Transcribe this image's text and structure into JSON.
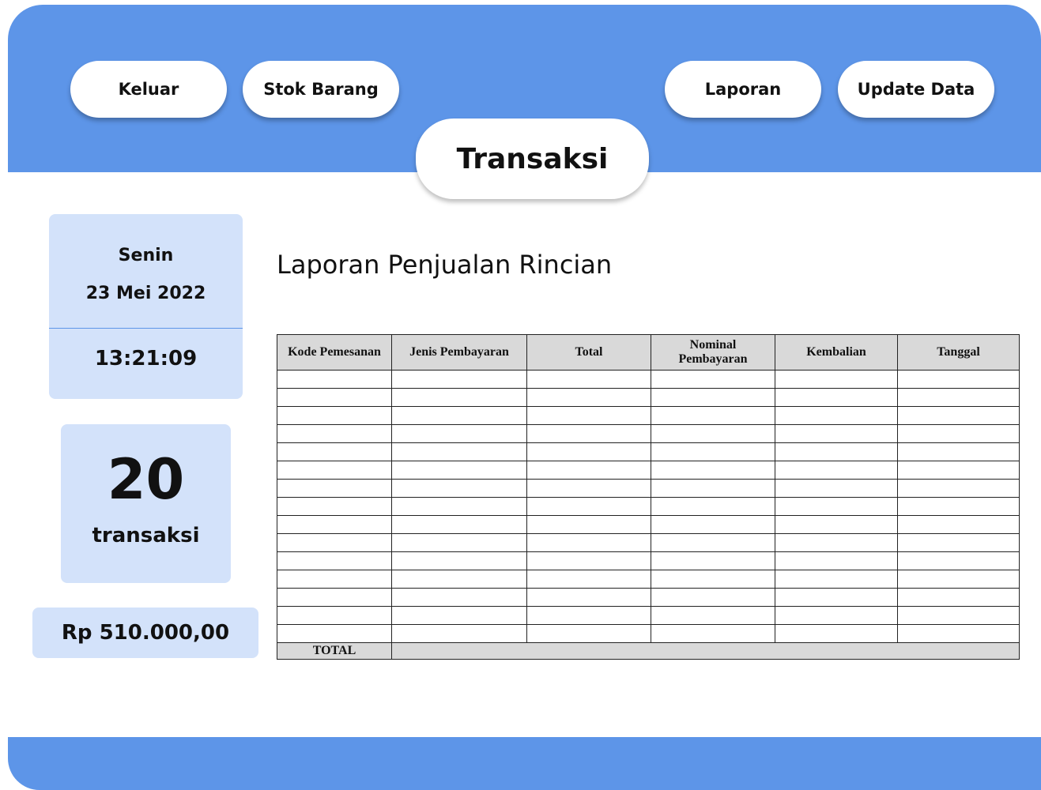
{
  "nav": {
    "keluar": "Keluar",
    "stok_barang": "Stok Barang",
    "laporan": "Laporan",
    "update_data": "Update Data"
  },
  "page_title": "Transaksi",
  "info": {
    "day": "Senin",
    "date": "23 Mei 2022",
    "time": "13:21:09",
    "transaction_count": "20",
    "transaction_label": "transaksi",
    "total_amount": "Rp 510.000,00"
  },
  "report": {
    "title": "Laporan Penjualan Rincian",
    "columns": [
      "Kode Pemesanan",
      "Jenis Pembayaran",
      "Total",
      "Nominal Pembayaran",
      "Kembalian",
      "Tanggal"
    ],
    "empty_row_count": 15,
    "total_label": "TOTAL"
  },
  "colors": {
    "primary": "#5d95e8",
    "card": "#d3e2fa",
    "table_header": "#d9d9d9"
  }
}
